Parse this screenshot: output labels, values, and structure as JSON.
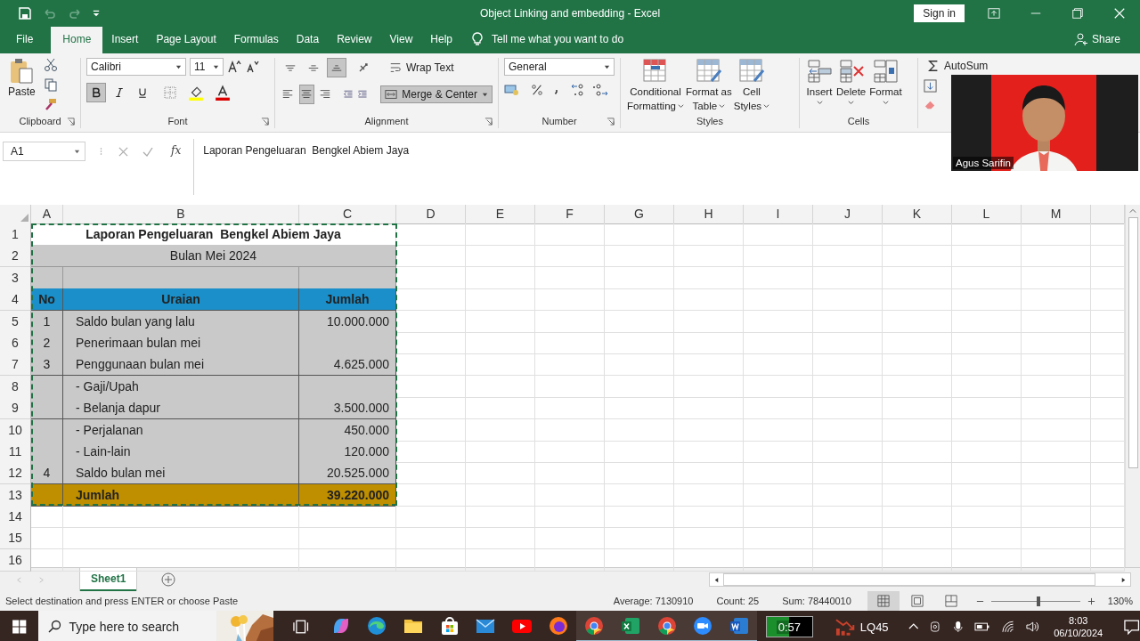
{
  "title_bar": {
    "title": "Object Linking and embedding  -  Excel",
    "sign_in": "Sign in"
  },
  "menu_tabs": [
    {
      "label": "File",
      "selected": false
    },
    {
      "label": "Home",
      "selected": true
    },
    {
      "label": "Insert",
      "selected": false
    },
    {
      "label": "Page Layout",
      "selected": false
    },
    {
      "label": "Formulas",
      "selected": false
    },
    {
      "label": "Data",
      "selected": false
    },
    {
      "label": "Review",
      "selected": false
    },
    {
      "label": "View",
      "selected": false
    },
    {
      "label": "Help",
      "selected": false
    }
  ],
  "tell_me": "Tell me what you want to do",
  "share": "Share",
  "ribbon": {
    "clipboard": {
      "label": "Clipboard",
      "paste": "Paste"
    },
    "font": {
      "label": "Font",
      "font_name": "Calibri",
      "font_size": "11",
      "bold": true,
      "italic": false,
      "underline": false
    },
    "alignment": {
      "label": "Alignment",
      "wrap_text": "Wrap Text",
      "merge_center": "Merge & Center",
      "merge_selected": true,
      "vertical": [
        {
          "selected": false
        },
        {
          "selected": false
        },
        {
          "selected": true
        }
      ],
      "horizontal": [
        {
          "selected": false
        },
        {
          "selected": true
        },
        {
          "selected": false
        }
      ]
    },
    "number": {
      "label": "Number",
      "format": "General"
    },
    "styles": {
      "label": "Styles",
      "buttons": [
        {
          "lines": [
            "Conditional",
            "Formatting"
          ]
        },
        {
          "lines": [
            "Format as",
            "Table"
          ]
        },
        {
          "lines": [
            "Cell",
            "Styles"
          ]
        }
      ]
    },
    "cells": {
      "label": "Cells",
      "buttons": [
        "Insert",
        "Delete",
        "Format"
      ]
    },
    "editing": {
      "autosum": "AutoSum"
    }
  },
  "webcam": {
    "kind": "picture",
    "caption": "Agus Sarifin"
  },
  "formula_bar": {
    "name_box": "A1",
    "fx": "fx",
    "formula": "Laporan Pengeluaran  Bengkel Abiem Jaya"
  },
  "sheet": {
    "columns": [
      "A",
      "B",
      "C",
      "D",
      "E",
      "F",
      "G",
      "H",
      "I",
      "J",
      "K",
      "L",
      "M"
    ],
    "copy_marquee": true,
    "rows": [
      {
        "n": "1",
        "kind": "title",
        "text": "Laporan Pengeluaran  Bengkel Abiem Jaya"
      },
      {
        "n": "2",
        "kind": "subtitle",
        "text": "Bulan Mei 2024"
      },
      {
        "n": "3",
        "kind": "blank"
      },
      {
        "n": "4",
        "kind": "header",
        "no": "No",
        "item": "Uraian",
        "amount": "Jumlah"
      },
      {
        "n": "5",
        "kind": "data",
        "no": "1",
        "item": "Saldo bulan yang lalu",
        "amount": "10.000.000"
      },
      {
        "n": "6",
        "kind": "data",
        "no": "2",
        "item": "Penerimaan bulan mei"
      },
      {
        "n": "7",
        "kind": "data",
        "no": "3",
        "item": "Penggunaan bulan mei",
        "amount": "4.625.000"
      },
      {
        "n": "8",
        "kind": "data",
        "item": "- Gaji/Upah"
      },
      {
        "n": "9",
        "kind": "data",
        "item": "- Belanja dapur",
        "amount": "3.500.000"
      },
      {
        "n": "10",
        "kind": "data",
        "item": "- Perjalanan",
        "amount": "450.000"
      },
      {
        "n": "11",
        "kind": "data",
        "item": "- Lain-lain",
        "amount": "120.000"
      },
      {
        "n": "12",
        "kind": "data",
        "no": "4",
        "item": "Saldo bulan mei",
        "amount": "20.525.000"
      },
      {
        "n": "13",
        "kind": "total",
        "item": "Jumlah",
        "amount": "39.220.000"
      },
      {
        "n": "14",
        "kind": "empty"
      },
      {
        "n": "15",
        "kind": "empty"
      },
      {
        "n": "16",
        "kind": "empty"
      }
    ]
  },
  "sheet_tabs": [
    {
      "label": "Sheet1",
      "selected": true
    }
  ],
  "status_bar": {
    "message": "Select destination and press ENTER or choose Paste",
    "average": "Average: 7130910",
    "count": "Count: 25",
    "sum": "Sum: 78440010",
    "views": [
      {
        "selected": true
      },
      {
        "selected": false
      },
      {
        "selected": false
      }
    ],
    "zoom": {
      "level": 0.53,
      "text": "130%"
    }
  },
  "taskbar": {
    "search": {
      "placeholder": "Type here to search"
    },
    "apps": [
      {
        "kind": "copilot",
        "running": false
      },
      {
        "kind": "edge",
        "running": false
      },
      {
        "kind": "folder",
        "running": false
      },
      {
        "kind": "store",
        "running": false
      },
      {
        "kind": "mail",
        "running": false
      },
      {
        "kind": "youtube",
        "running": false
      },
      {
        "kind": "firefox",
        "running": false
      },
      {
        "kind": "chrome",
        "running": true
      },
      {
        "kind": "excel",
        "running": true
      },
      {
        "kind": "chrome",
        "running": true
      },
      {
        "kind": "zoom",
        "running": true
      },
      {
        "kind": "word",
        "running": true
      }
    ],
    "timer": {
      "text": "0:57",
      "level": 0.5
    },
    "stock": "LQ45",
    "time": "8:03",
    "date": "06/10/2024"
  }
}
